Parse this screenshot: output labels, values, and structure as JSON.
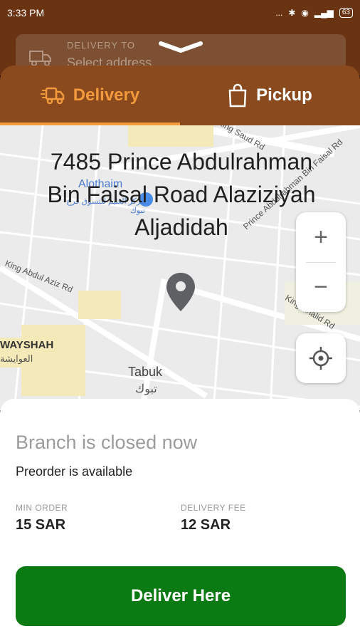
{
  "status": {
    "time": "3:33 PM",
    "signal": "...",
    "battery": "63"
  },
  "address_bar": {
    "label": "DELIVERY TO",
    "value": "Select address"
  },
  "tabs": [
    {
      "label": "Delivery",
      "active": true
    },
    {
      "label": "Pickup",
      "active": false
    }
  ],
  "map": {
    "address": "7485 Prince Abdulrahman Bin Faisal Road Alaziziyah Aljadidah",
    "labels": {
      "king_saud": "King Saud Rd",
      "prince_abdul": "Prince Abdulrahman Bin Faisal Rd",
      "king_abdulaziz": "King Abdul Aziz Rd",
      "king_khalid": "King Khalid Rd",
      "wayshah": "WAYSHAH",
      "wayshah_ar": "العوايشة",
      "tabuk": "Tabuk",
      "tabuk_ar": "تبوك",
      "alothaim": "Alothaim",
      "alothaim_ar": "مركز العثيم للتسوق فرع تبوك"
    },
    "zoom_in": "+",
    "zoom_out": "−"
  },
  "sheet": {
    "closed": "Branch is closed now",
    "preorder": "Preorder is available",
    "min_order_label": "MIN ORDER",
    "min_order_value": "15 SAR",
    "fee_label": "DELIVERY FEE",
    "fee_value": "12 SAR",
    "button": "Deliver Here"
  },
  "colors": {
    "brand": "#8a4a1e",
    "accent": "#f29a3c",
    "button": "#0a7b12"
  }
}
